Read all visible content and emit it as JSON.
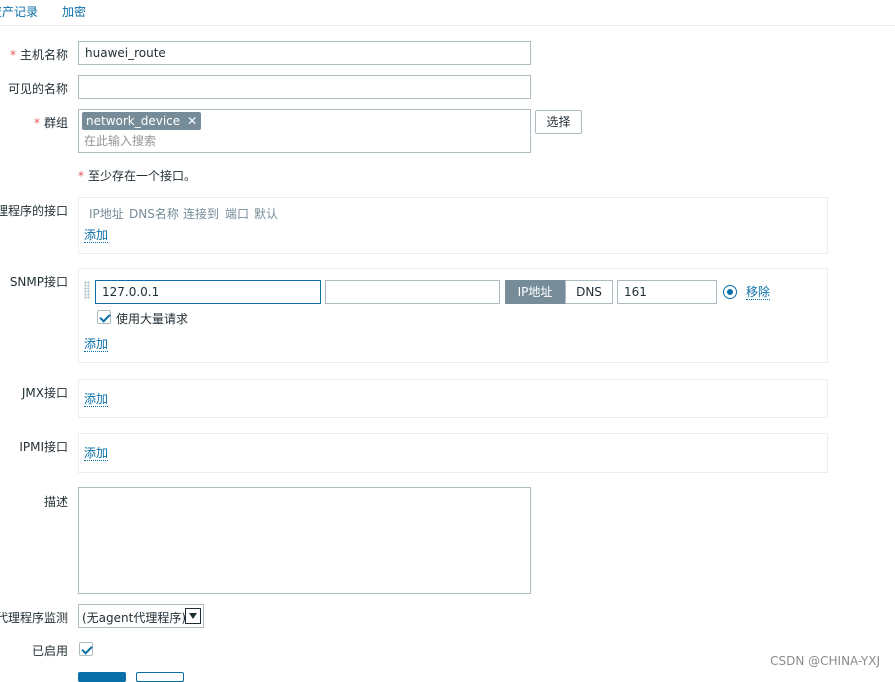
{
  "tabs": {
    "asset_record": "资产记录",
    "encryption": "加密"
  },
  "form": {
    "host_name": {
      "label": "主机名称",
      "required_mark": "*",
      "value": "huawei_route"
    },
    "visible_name": {
      "label": "可见的名称",
      "value": ""
    },
    "groups": {
      "label": "群组",
      "required_mark": "*",
      "chip": "network_device",
      "chip_remove": "✕",
      "placeholder": "在此输入搜索",
      "select_button": "选择"
    },
    "interface_note": {
      "required_mark": "*",
      "text": "至少存在一个接口。"
    },
    "agent_interfaces": {
      "label": "代理程序的接口",
      "columns": [
        "IP地址",
        "DNS名称",
        "连接到",
        "端口",
        "默认"
      ],
      "add": "添加"
    },
    "snmp_interfaces": {
      "label": "SNMP接口",
      "ip": "127.0.0.1",
      "dns": "",
      "connect_ip": "IP地址",
      "connect_dns": "DNS",
      "port": "161",
      "remove": "移除",
      "bulk_label": "使用大量请求",
      "bulk_checked": true,
      "default_selected": true,
      "add": "添加"
    },
    "jmx_interfaces": {
      "label": "JMX接口",
      "add": "添加"
    },
    "ipmi_interfaces": {
      "label": "IPMI接口",
      "add": "添加"
    },
    "description": {
      "label": "描述",
      "value": ""
    },
    "proxy": {
      "label": "由代理程序监测",
      "selected": "(无agent代理程序)"
    },
    "enabled": {
      "label": "已启用",
      "checked": true
    }
  },
  "colors": {
    "link": "#0a6fa8",
    "accent_button": "#768d99",
    "primary_button": "#0a6fa8",
    "required": "#e45959"
  },
  "watermark": "CSDN @CHINA-YXJ"
}
